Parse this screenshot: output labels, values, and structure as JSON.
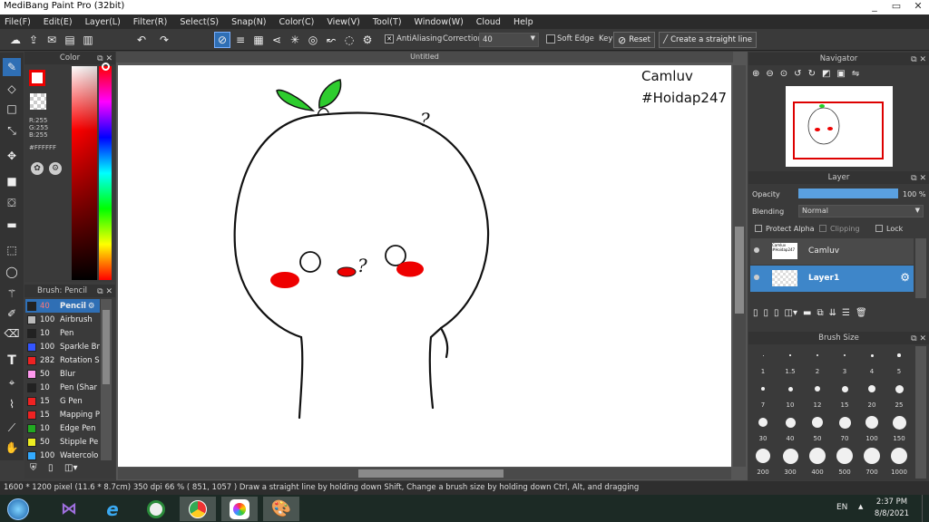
{
  "window": {
    "title": "MediBang Paint Pro (32bit)",
    "min": "_",
    "restore": "▭",
    "close": "✕"
  },
  "menu": [
    "File(F)",
    "Edit(E)",
    "Layer(L)",
    "Filter(R)",
    "Select(S)",
    "Snap(N)",
    "Color(C)",
    "View(V)",
    "Tool(T)",
    "Window(W)",
    "Cloud",
    "Help"
  ],
  "toolbar": {
    "antialiasing": "AntiAliasing",
    "correction_label": "Correction",
    "correction_value": "40",
    "soft_edge": "Soft Edge",
    "key_label": "Key",
    "reset": "Reset",
    "straight_line": "Create a straight line"
  },
  "color_panel": {
    "title": "Color",
    "r": "R:255",
    "g": "G:255",
    "b": "B:255",
    "hex": "#FFFFFF",
    "colors": {
      "primary": "#ff0000",
      "secondary": "#ffffff"
    }
  },
  "brush_panel": {
    "title": "Brush: Pencil",
    "items": [
      {
        "size": "40",
        "name": "Pencil",
        "color": "#222222",
        "selected": true
      },
      {
        "size": "100",
        "name": "Airbrush",
        "color": "#bbbbbb"
      },
      {
        "size": "10",
        "name": "Pen",
        "color": "#222222"
      },
      {
        "size": "100",
        "name": "Sparkle Br",
        "color": "#3355ff"
      },
      {
        "size": "282",
        "name": "Rotation S",
        "color": "#ee2222"
      },
      {
        "size": "50",
        "name": "Blur",
        "color": "#ff99ee"
      },
      {
        "size": "10",
        "name": "Pen (Shar",
        "color": "#222222"
      },
      {
        "size": "15",
        "name": "G Pen",
        "color": "#ee2222"
      },
      {
        "size": "15",
        "name": "Mapping P",
        "color": "#ee2222"
      },
      {
        "size": "10",
        "name": "Edge Pen",
        "color": "#22aa22"
      },
      {
        "size": "50",
        "name": "Stipple Pe",
        "color": "#eeee22"
      },
      {
        "size": "100",
        "name": "Watercolo",
        "color": "#33aaff"
      }
    ]
  },
  "canvas": {
    "tab_title": "Untitled",
    "text_name": "Camluv",
    "text_tag": "#Hoidap247",
    "question_marks": [
      "?",
      "?"
    ]
  },
  "navigator": {
    "title": "Navigator"
  },
  "layer_panel": {
    "title": "Layer",
    "opacity_label": "Opacity",
    "opacity_value": "100 %",
    "blending_label": "Blending",
    "blending_value": "Normal",
    "protect_alpha": "Protect Alpha",
    "clipping": "Clipping",
    "lock": "Lock",
    "layers": [
      {
        "name": "Camluv",
        "thumb_text": "Camluv #Hoidap247"
      },
      {
        "name": "Layer1",
        "selected": true
      }
    ]
  },
  "brush_size": {
    "title": "Brush Size",
    "sizes": [
      "1",
      "1.5",
      "2",
      "3",
      "4",
      "5",
      "7",
      "10",
      "12",
      "15",
      "20",
      "25",
      "30",
      "40",
      "50",
      "70",
      "100",
      "150",
      "200",
      "300",
      "400",
      "500",
      "700",
      "1000"
    ]
  },
  "status": "1600 * 1200 pixel   (11.6 * 8.7cm)   350 dpi   66 %   ( 851, 1057 )   Draw a straight line by holding down Shift, Change a brush size by holding down Ctrl, Alt, and dragging",
  "taskbar": {
    "lang": "EN",
    "time": "2:37 PM",
    "date": "8/8/2021",
    "tray_arrow": "▲"
  }
}
